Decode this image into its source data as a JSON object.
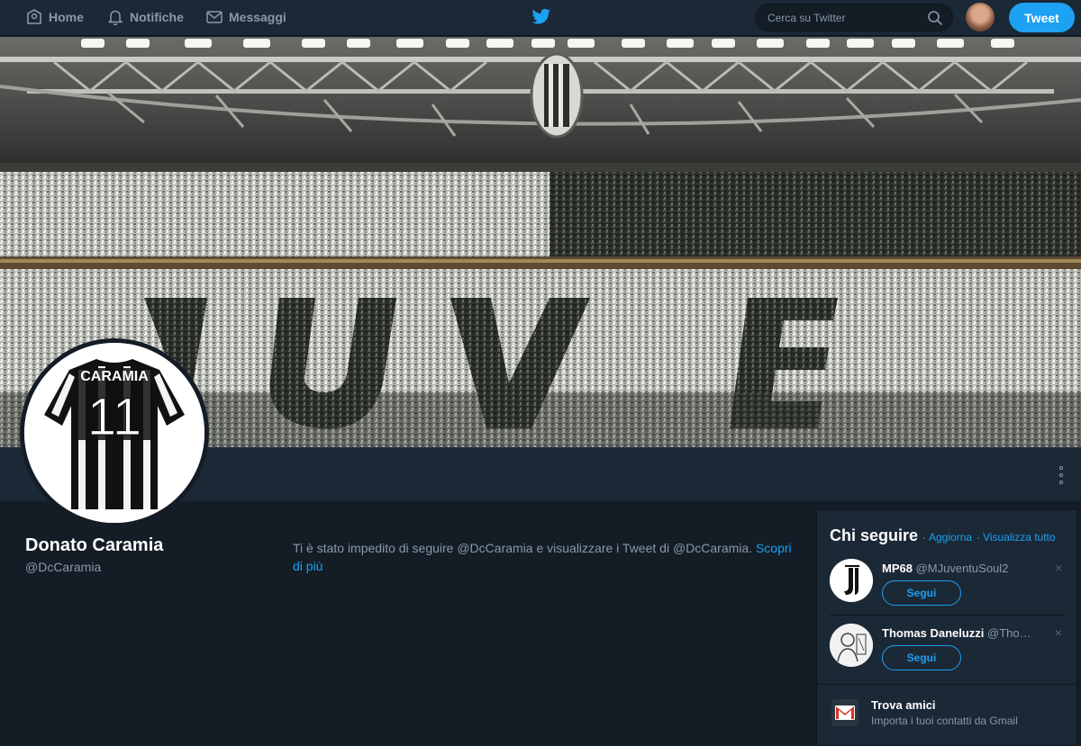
{
  "nav": {
    "home": "Home",
    "notifications": "Notifiche",
    "messages": "Messaggi",
    "search_placeholder": "Cerca su Twitter",
    "tweet_button": "Tweet"
  },
  "avatar_jersey": {
    "name": "CARAMIA",
    "number": "11"
  },
  "profile": {
    "display_name": "Donato Caramia",
    "handle": "@DcCaramia",
    "blocked_text": "Ti è stato impedito di seguire @DcCaramia e visualizzare i Tweet di @DcCaramia.",
    "learn_more": "Scopri di più"
  },
  "who_to_follow": {
    "title": "Chi seguire",
    "separator": "·",
    "refresh": "Aggiorna",
    "view_all": "Visualizza tutto",
    "suggestions": [
      {
        "name": "MP68",
        "handle": "@MJuventuSoul2",
        "follow_label": "Segui",
        "close": "×"
      },
      {
        "name": "Thomas Daneluzzi",
        "handle": "@Tho…",
        "follow_label": "Segui",
        "close": "×"
      }
    ]
  },
  "find_friends": {
    "title": "Trova amici",
    "subtitle": "Importa i tuoi contatti da Gmail"
  },
  "colors": {
    "accent": "#1da1f2",
    "background": "#141d26",
    "panel": "#1b2836",
    "muted_text": "#8899a6"
  },
  "icons": [
    "home-icon",
    "bell-icon",
    "envelope-icon",
    "twitter-bird-icon",
    "search-icon",
    "more-dots-icon",
    "gmail-icon",
    "close-icon"
  ]
}
